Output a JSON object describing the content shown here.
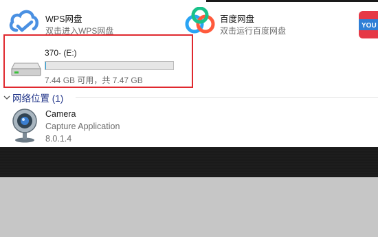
{
  "apps": {
    "wps": {
      "title": "WPS网盘",
      "subtitle": "双击进入WPS网盘",
      "icon": "wps-cloud-icon"
    },
    "baidu": {
      "title": "百度网盘",
      "subtitle": "双击运行百度网盘",
      "icon": "baidu-netdisk-icon"
    },
    "third": {
      "badge": "YOU",
      "icon": "youku-icon"
    }
  },
  "drive": {
    "label": "370- (E:)",
    "space_text": "7.44 GB 可用，共 7.47 GB",
    "used_fraction": 0.004,
    "icon": "usb-drive-icon"
  },
  "network_group": {
    "header": "网络位置 (1)",
    "icon": "chevron-down-icon"
  },
  "camera": {
    "title": "Camera",
    "line2": "Capture Application",
    "line3": "8.0.1.4",
    "icon": "webcam-icon"
  },
  "colors": {
    "accent_red": "#e0282e",
    "group_header": "#1e3287",
    "wps_blue": "#4a90e2",
    "youku_red": "#e63946"
  }
}
